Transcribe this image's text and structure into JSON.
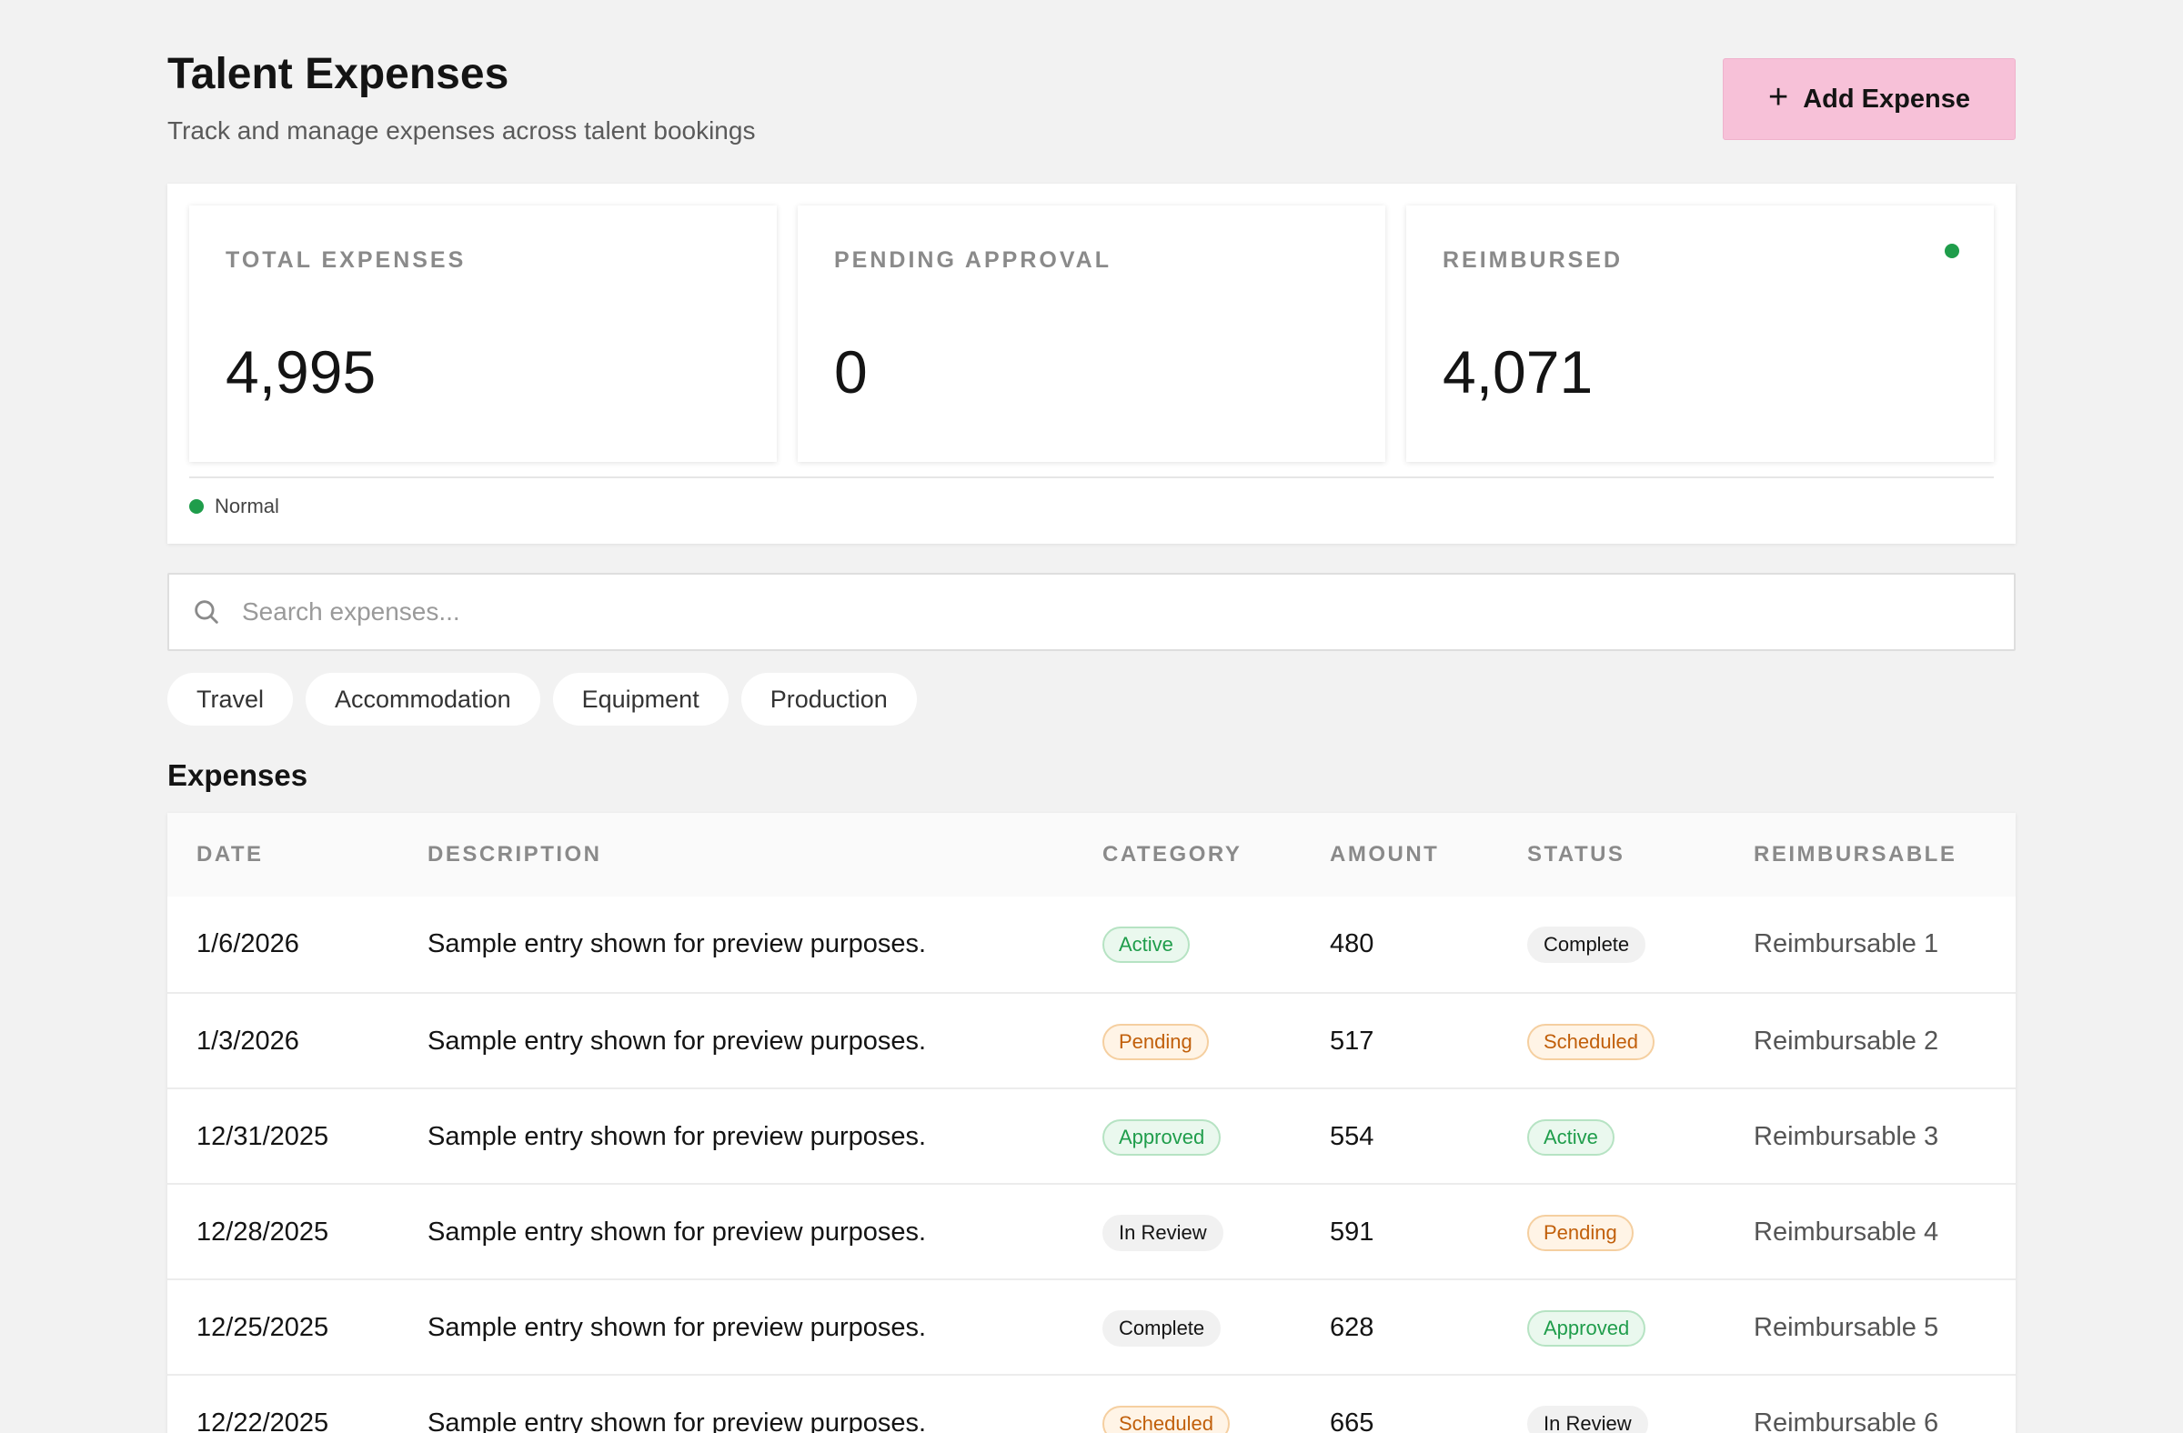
{
  "header": {
    "title": "Talent Expenses",
    "subtitle": "Track and manage expenses across talent bookings",
    "add_button_label": "Add Expense"
  },
  "stats": [
    {
      "label": "TOTAL EXPENSES",
      "value": "4,995"
    },
    {
      "label": "PENDING APPROVAL",
      "value": "0"
    },
    {
      "label": "REIMBURSED",
      "value": "4,071"
    }
  ],
  "status": {
    "label": "Normal",
    "color": "#1f9d4b"
  },
  "search": {
    "placeholder": "Search expenses...",
    "value": ""
  },
  "filters": [
    "Travel",
    "Accommodation",
    "Equipment",
    "Production"
  ],
  "section_title": "Expenses",
  "table": {
    "columns": [
      "DATE",
      "DESCRIPTION",
      "CATEGORY",
      "AMOUNT",
      "STATUS",
      "REIMBURSABLE"
    ],
    "rows": [
      {
        "date": "1/6/2026",
        "description": "Sample entry shown for preview purposes.",
        "category": "Active",
        "category_tone": "green",
        "amount": "480",
        "status": "Complete",
        "status_tone": "gray",
        "reimbursable": "Reimbursable 1"
      },
      {
        "date": "1/3/2026",
        "description": "Sample entry shown for preview purposes.",
        "category": "Pending",
        "category_tone": "orange",
        "amount": "517",
        "status": "Scheduled",
        "status_tone": "orange",
        "reimbursable": "Reimbursable 2"
      },
      {
        "date": "12/31/2025",
        "description": "Sample entry shown for preview purposes.",
        "category": "Approved",
        "category_tone": "green",
        "amount": "554",
        "status": "Active",
        "status_tone": "green",
        "reimbursable": "Reimbursable 3"
      },
      {
        "date": "12/28/2025",
        "description": "Sample entry shown for preview purposes.",
        "category": "In Review",
        "category_tone": "gray",
        "amount": "591",
        "status": "Pending",
        "status_tone": "orange",
        "reimbursable": "Reimbursable 4"
      },
      {
        "date": "12/25/2025",
        "description": "Sample entry shown for preview purposes.",
        "category": "Complete",
        "category_tone": "gray",
        "amount": "628",
        "status": "Approved",
        "status_tone": "green",
        "reimbursable": "Reimbursable 5"
      },
      {
        "date": "12/22/2025",
        "description": "Sample entry shown for preview purposes.",
        "category": "Scheduled",
        "category_tone": "orange",
        "amount": "665",
        "status": "In Review",
        "status_tone": "gray",
        "reimbursable": "Reimbursable 6"
      }
    ]
  },
  "colors": {
    "accent_button": "#f7c1d8",
    "status_green": "#1f9d4b",
    "status_orange": "#c15f0a",
    "background": "#f2f2f2"
  },
  "icons": {
    "add": "plus-icon",
    "search": "search-icon",
    "status": "status-dot-icon"
  }
}
